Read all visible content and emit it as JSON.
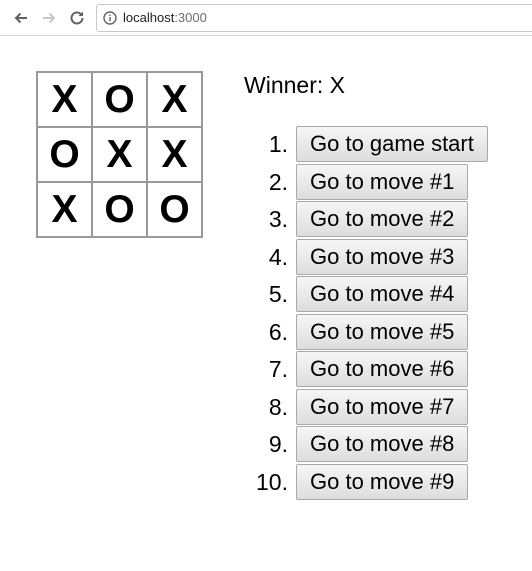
{
  "browser": {
    "url_host": "localhost",
    "url_port": ":3000",
    "icons": {
      "back": "back-arrow-icon",
      "forward": "forward-arrow-icon",
      "reload": "reload-icon",
      "info": "info-icon"
    }
  },
  "board": {
    "rows": [
      [
        "X",
        "O",
        "X"
      ],
      [
        "O",
        "X",
        "X"
      ],
      [
        "X",
        "O",
        "O"
      ]
    ]
  },
  "status": "Winner: X",
  "moves": [
    {
      "number": "1.",
      "label": "Go to game start"
    },
    {
      "number": "2.",
      "label": "Go to move #1"
    },
    {
      "number": "3.",
      "label": "Go to move #2"
    },
    {
      "number": "4.",
      "label": "Go to move #3"
    },
    {
      "number": "5.",
      "label": "Go to move #4"
    },
    {
      "number": "6.",
      "label": "Go to move #5"
    },
    {
      "number": "7.",
      "label": "Go to move #6"
    },
    {
      "number": "8.",
      "label": "Go to move #7"
    },
    {
      "number": "9.",
      "label": "Go to move #8"
    },
    {
      "number": "10.",
      "label": "Go to move #9"
    }
  ]
}
